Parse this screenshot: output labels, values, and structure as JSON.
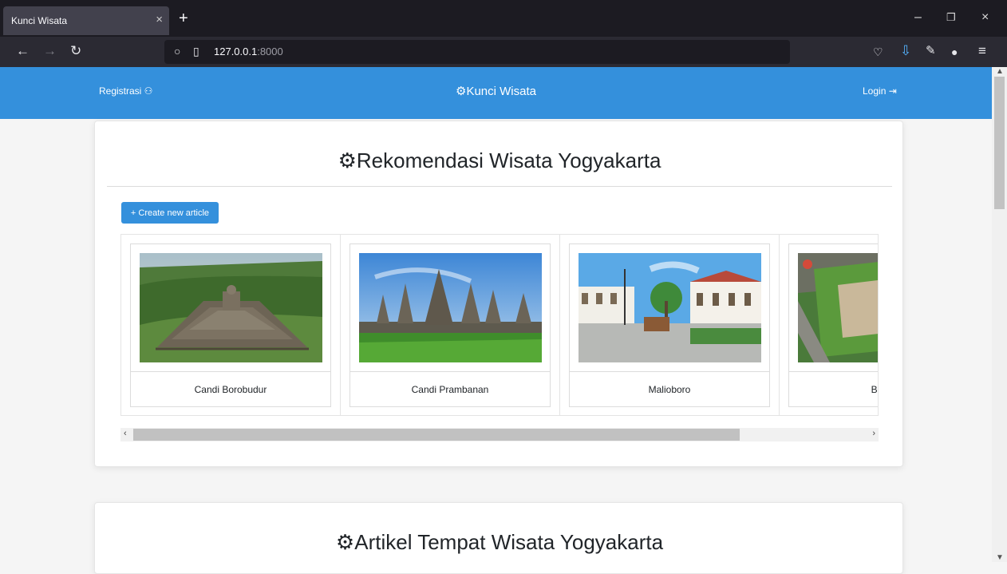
{
  "browser": {
    "tab_title": "Kunci Wisata",
    "tab_close": "×",
    "new_tab": "+",
    "url_host": "127.0.0.1",
    "url_port": ":8000",
    "win_min": "–",
    "win_restore": "❐",
    "win_close": "×"
  },
  "header": {
    "register_label": "Registrasi ⚇",
    "brand": "⚙Kunci Wisata",
    "login_label": "Login ⇥"
  },
  "recommend": {
    "title": "⚙Rekomendasi Wisata Yogyakarta",
    "create_button": "+ Create new article",
    "items": [
      {
        "name": "Candi Borobudur"
      },
      {
        "name": "Candi Prambanan"
      },
      {
        "name": "Malioboro"
      },
      {
        "name": "Benteng"
      }
    ]
  },
  "articles": {
    "title": "⚙Artikel Tempat Wisata Yogyakarta"
  }
}
